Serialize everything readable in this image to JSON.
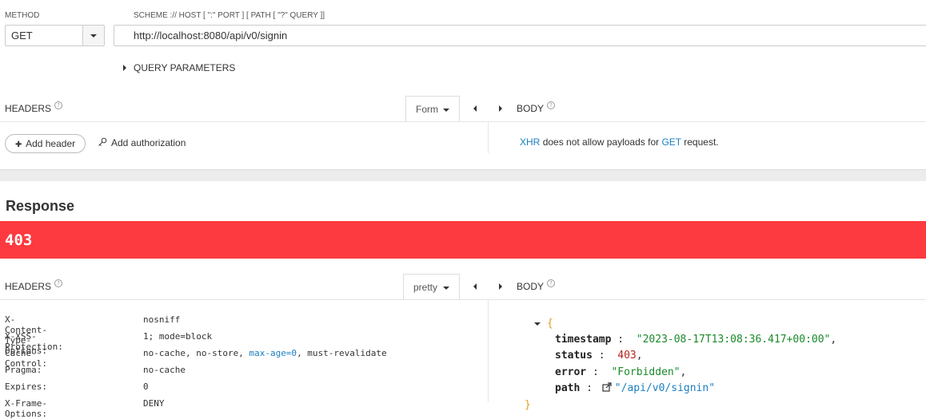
{
  "request": {
    "method_label": "METHOD",
    "method_value": "GET",
    "url_label": "SCHEME :// HOST [ \":\" PORT ] [ PATH [ \"?\" QUERY ]]",
    "url_value": "http://localhost:8080/api/v0/signin",
    "query_params_label": "QUERY PARAMETERS",
    "headers_label": "HEADERS",
    "headers_mode": "Form",
    "body_label": "BODY",
    "add_header_label": "Add header",
    "add_authorization_label": "Add authorization",
    "body_note": {
      "xhr": "XHR",
      "middle": "does not allow payloads for",
      "method": "GET",
      "end": "request."
    }
  },
  "response": {
    "title": "Response",
    "status_code": "403",
    "status_color": "#fc3a3f",
    "headers_label": "HEADERS",
    "headers_mode": "pretty",
    "body_label": "BODY",
    "headers": [
      {
        "key": "X-Content-Type-Options:",
        "value": "nosniff"
      },
      {
        "key": "X-XSS-Protection:",
        "value": "1; mode=block"
      },
      {
        "key": "Cache-Control:",
        "value_a": "no-cache, no-store, ",
        "value_link": "max-age=0",
        "value_b": ", must-revalidate"
      },
      {
        "key": "Pragma:",
        "value": "no-cache"
      },
      {
        "key": "Expires:",
        "value": "0"
      },
      {
        "key": "X-Frame-Options:",
        "value": "DENY"
      }
    ],
    "body": {
      "open_brace": "{",
      "fields": [
        {
          "key": "timestamp",
          "value": "\"2023-08-17T13:08:36.417+00:00\"",
          "type": "string"
        },
        {
          "key": "status",
          "value": "403",
          "type": "number"
        },
        {
          "key": "error",
          "value": "\"Forbidden\"",
          "type": "string"
        },
        {
          "key": "path",
          "value": "\"/api/v0/signin\"",
          "type": "link"
        }
      ],
      "close_brace": "}"
    }
  },
  "icons": {
    "help": "?",
    "plus": "✚",
    "key": "key-icon",
    "external": "external-link-icon"
  }
}
